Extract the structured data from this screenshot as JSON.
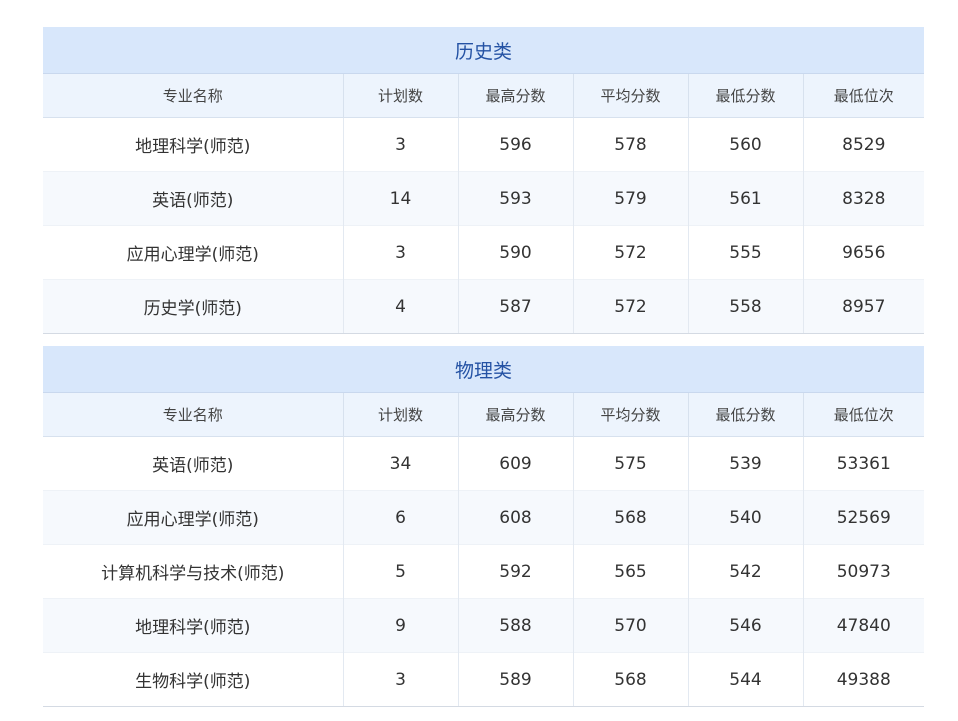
{
  "headers": [
    "专业名称",
    "计划数",
    "最高分数",
    "平均分数",
    "最低分数",
    "最低位次"
  ],
  "history": {
    "title": "历史类",
    "rows": [
      [
        "地理科学(师范)",
        "3",
        "596",
        "578",
        "560",
        "8529"
      ],
      [
        "英语(师范)",
        "14",
        "593",
        "579",
        "561",
        "8328"
      ],
      [
        "应用心理学(师范)",
        "3",
        "590",
        "572",
        "555",
        "9656"
      ],
      [
        "历史学(师范)",
        "4",
        "587",
        "572",
        "558",
        "8957"
      ]
    ]
  },
  "physics": {
    "title": "物理类",
    "rows": [
      [
        "英语(师范)",
        "34",
        "609",
        "575",
        "539",
        "53361"
      ],
      [
        "应用心理学(师范)",
        "6",
        "608",
        "568",
        "540",
        "52569"
      ],
      [
        "计算机科学与技术(师范)",
        "5",
        "592",
        "565",
        "542",
        "50973"
      ],
      [
        "地理科学(师范)",
        "9",
        "588",
        "570",
        "546",
        "47840"
      ],
      [
        "生物科学(师范)",
        "3",
        "589",
        "568",
        "544",
        "49388"
      ]
    ]
  },
  "colors": {
    "title_bg": "#d8e7fb",
    "title_text": "#2452a4",
    "header_bg": "#edf4fd"
  }
}
